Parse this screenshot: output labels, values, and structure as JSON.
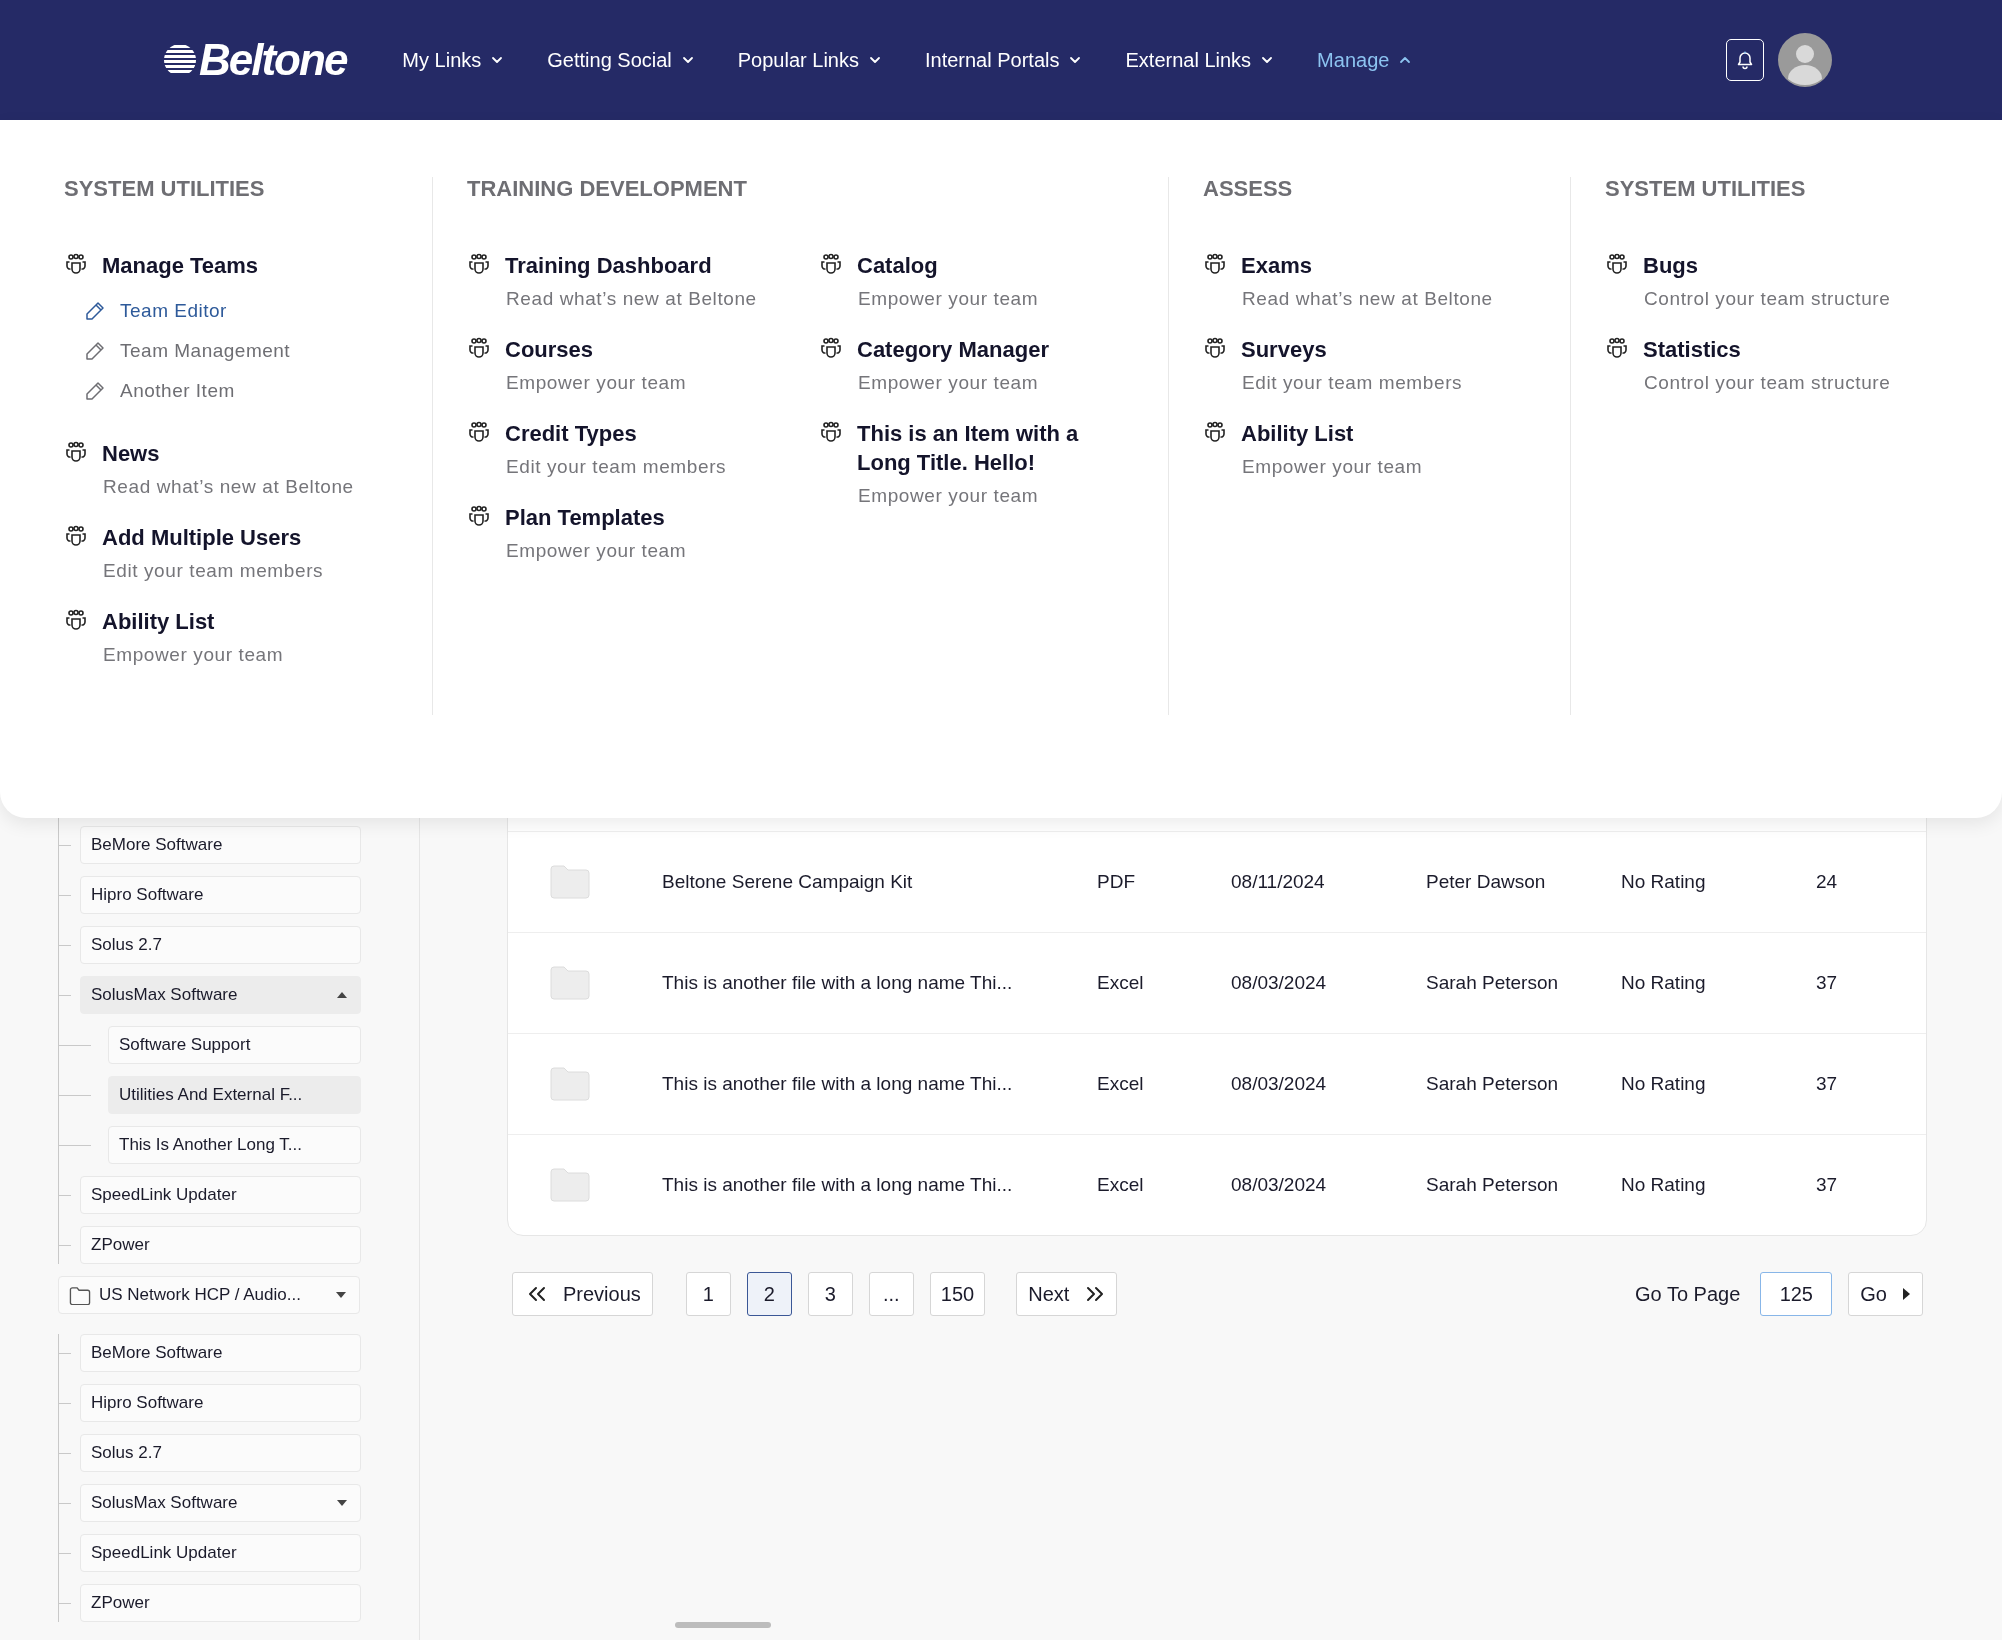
{
  "header": {
    "logo": "Beltone",
    "nav": [
      {
        "label": "My Links",
        "selected": false
      },
      {
        "label": "Getting Social",
        "selected": false
      },
      {
        "label": "Popular Links",
        "selected": false
      },
      {
        "label": "Internal Portals",
        "selected": false
      },
      {
        "label": "External Links",
        "selected": false
      },
      {
        "label": "Manage",
        "selected": true
      }
    ]
  },
  "menu": {
    "columns": [
      {
        "heading": "SYSTEM UTILITIES",
        "lists": [
          [
            {
              "title": "Manage Teams",
              "links": [
                {
                  "label": "Team Editor",
                  "selected": true
                },
                {
                  "label": "Team Management",
                  "selected": false
                },
                {
                  "label": "Another Item",
                  "selected": false
                }
              ]
            },
            {
              "title": "News",
              "subtitle": "Read what’s new at Beltone"
            },
            {
              "title": "Add Multiple Users",
              "subtitle": "Edit your team members"
            },
            {
              "title": "Ability List",
              "subtitle": "Empower your team"
            }
          ]
        ]
      },
      {
        "heading": "TRAINING DEVELOPMENT",
        "lists": [
          [
            {
              "title": "Training Dashboard",
              "subtitle": "Read what’s new at Beltone"
            },
            {
              "title": "Courses",
              "subtitle": "Empower your team"
            },
            {
              "title": "Credit Types",
              "subtitle": "Edit your team members"
            },
            {
              "title": "Plan Templates",
              "subtitle": "Empower your team"
            }
          ],
          [
            {
              "title": "Catalog",
              "subtitle": "Empower your team"
            },
            {
              "title": "Category Manager",
              "subtitle": "Empower your team"
            },
            {
              "title": "This is an Item with a Long Title. Hello!",
              "subtitle": "Empower your team"
            }
          ]
        ]
      },
      {
        "heading": "ASSESS",
        "lists": [
          [
            {
              "title": "Exams",
              "subtitle": "Read what’s new at Beltone"
            },
            {
              "title": "Surveys",
              "subtitle": "Edit your team members"
            },
            {
              "title": "Ability List",
              "subtitle": "Empower your team"
            }
          ]
        ]
      },
      {
        "heading": "SYSTEM UTILITIES",
        "lists": [
          [
            {
              "title": "Bugs",
              "subtitle": "Control your team structure"
            },
            {
              "title": "Statistics",
              "subtitle": "Control your team structure"
            }
          ]
        ]
      }
    ]
  },
  "sidebar": {
    "groups": [
      {
        "children": [
          {
            "label": "BeMore Software",
            "selected": false
          },
          {
            "label": "Hipro Software",
            "selected": false
          },
          {
            "label": "Solus 2.7",
            "selected": false
          },
          {
            "label": "SolusMax Software",
            "selected": true,
            "expanded": true,
            "children": [
              {
                "label": "Software Support",
                "selected": false
              },
              {
                "label": "Utilities And External F...",
                "selected": true
              },
              {
                "label": "This Is Another Long T...",
                "selected": false
              }
            ]
          },
          {
            "label": "SpeedLink Updater",
            "selected": false
          },
          {
            "label": "ZPower",
            "selected": false
          }
        ]
      },
      {
        "label": "US Network HCP / Audio...",
        "expanded": false,
        "children": [
          {
            "label": "BeMore Software",
            "selected": false
          },
          {
            "label": "Hipro Software",
            "selected": false
          },
          {
            "label": "Solus 2.7",
            "selected": false
          },
          {
            "label": "SolusMax Software",
            "selected": false,
            "expanded": false
          },
          {
            "label": "SpeedLink Updater",
            "selected": false
          },
          {
            "label": "ZPower",
            "selected": false
          }
        ]
      }
    ]
  },
  "table": {
    "rows": [
      [
        "Beltone Serene Campaign Kit",
        "PDF",
        "08/11/2024",
        "Peter Dawson",
        "No Rating",
        "24"
      ],
      [
        "This is another file with a long name Thi...",
        "Excel",
        "08/03/2024",
        "Sarah Peterson",
        "No Rating",
        "37"
      ],
      [
        "This is another file with a long name Thi...",
        "Excel",
        "08/03/2024",
        "Sarah Peterson",
        "No Rating",
        "37"
      ],
      [
        "This is another file with a long name Thi...",
        "Excel",
        "08/03/2024",
        "Sarah Peterson",
        "No Rating",
        "37"
      ]
    ]
  },
  "pagination": {
    "previous": "Previous",
    "next": "Next",
    "pages": [
      {
        "label": "1",
        "selected": false
      },
      {
        "label": "2",
        "selected": true
      },
      {
        "label": "3",
        "selected": false
      },
      {
        "label": "...",
        "selected": false
      },
      {
        "label": "150",
        "selected": false
      }
    ],
    "goto_label": "Go To Page",
    "goto_value": "125",
    "go": "Go"
  }
}
